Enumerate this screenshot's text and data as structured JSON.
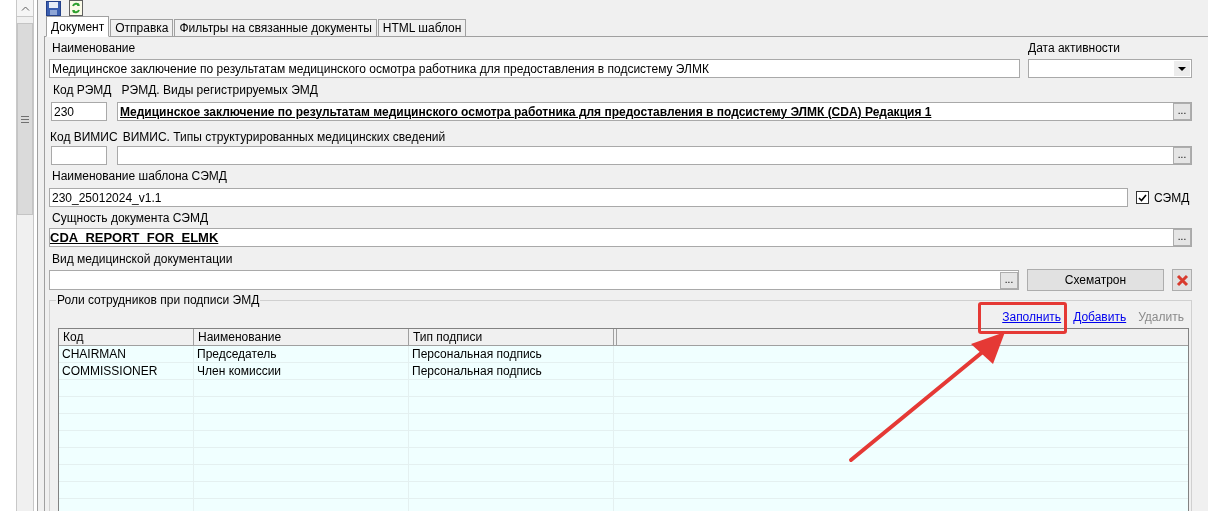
{
  "tabs": [
    {
      "label": "Документ",
      "selected": true
    },
    {
      "label": "Отправка",
      "selected": false
    },
    {
      "label": "Фильтры на связанные документы",
      "selected": false
    },
    {
      "label": "HTML шаблон",
      "selected": false
    }
  ],
  "name": {
    "label": "Наименование",
    "value": "Медицинское заключение по результатам медицинского осмотра работника для предоставления в подсистему ЭЛМК"
  },
  "activity_date": {
    "label": "Дата активности"
  },
  "remd": {
    "code_label": "Код РЭМД",
    "code": "230",
    "type_label": "РЭМД. Виды регистрируемых ЭМД",
    "type_value": "Медицинское заключение по результатам медицинского осмотра работника для предоставления в подсистему ЭЛМК (CDA) Редакция 1",
    "browse": "..."
  },
  "vimis": {
    "code_label": "Код ВИМИС",
    "type_label": "ВИМИС. Типы структурированных медицинских сведений",
    "browse": "..."
  },
  "template": {
    "label": "Наименование шаблона СЭМД",
    "value": "230_25012024_v1.1",
    "semd": {
      "label": "СЭМД",
      "checked": true
    }
  },
  "entity": {
    "label": "Сущность документа СЭМД",
    "value": "CDA_REPORT_FOR_ELMK",
    "browse": "..."
  },
  "doc_kind": {
    "label": "Вид медицинской документации",
    "browse": "...",
    "schematron_button": "Схематрон"
  },
  "roles": {
    "title": "Роли сотрудников при подписи ЭМД",
    "actions": [
      {
        "label": "Заполнить",
        "disabled": false,
        "highlighted": true
      },
      {
        "label": "Добавить",
        "disabled": false,
        "highlighted": false
      },
      {
        "label": "Удалить",
        "disabled": true,
        "highlighted": false
      }
    ],
    "columns": [
      "Код",
      "Наименование",
      "Тип подписи"
    ],
    "rows": [
      [
        "CHAIRMAN",
        "Председатель",
        "Персональная подпись"
      ],
      [
        "COMMISSIONER",
        "Член комиссии",
        "Персональная подпись"
      ]
    ]
  }
}
